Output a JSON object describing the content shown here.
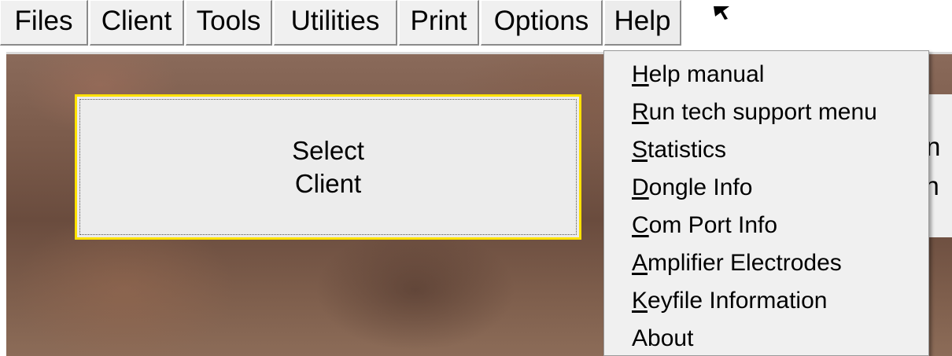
{
  "menubar": {
    "items": [
      {
        "label": "Files"
      },
      {
        "label": "Client"
      },
      {
        "label": "Tools"
      },
      {
        "label": "Utilities"
      },
      {
        "label": "Print"
      },
      {
        "label": "Options"
      },
      {
        "label": "Help"
      }
    ]
  },
  "main": {
    "select_client": {
      "line1": "Select",
      "line2": "Client"
    },
    "side_panel": {
      "fragment1": "n",
      "fragment2": "on"
    }
  },
  "help_menu": {
    "items": [
      {
        "mnemonic": "H",
        "rest": "elp manual"
      },
      {
        "mnemonic": "R",
        "rest": "un tech support menu"
      },
      {
        "mnemonic": "S",
        "rest": "tatistics"
      },
      {
        "mnemonic": "D",
        "rest": "ongle Info"
      },
      {
        "mnemonic": "C",
        "rest": "om Port Info"
      },
      {
        "mnemonic": "A",
        "rest": "mplifier Electrodes"
      },
      {
        "mnemonic": "K",
        "rest": "eyfile Information"
      },
      {
        "mnemonic": "",
        "rest": "About"
      }
    ]
  },
  "colors": {
    "menu_bg": "#f0f0f0",
    "button_focus_border": "#ffe100"
  }
}
